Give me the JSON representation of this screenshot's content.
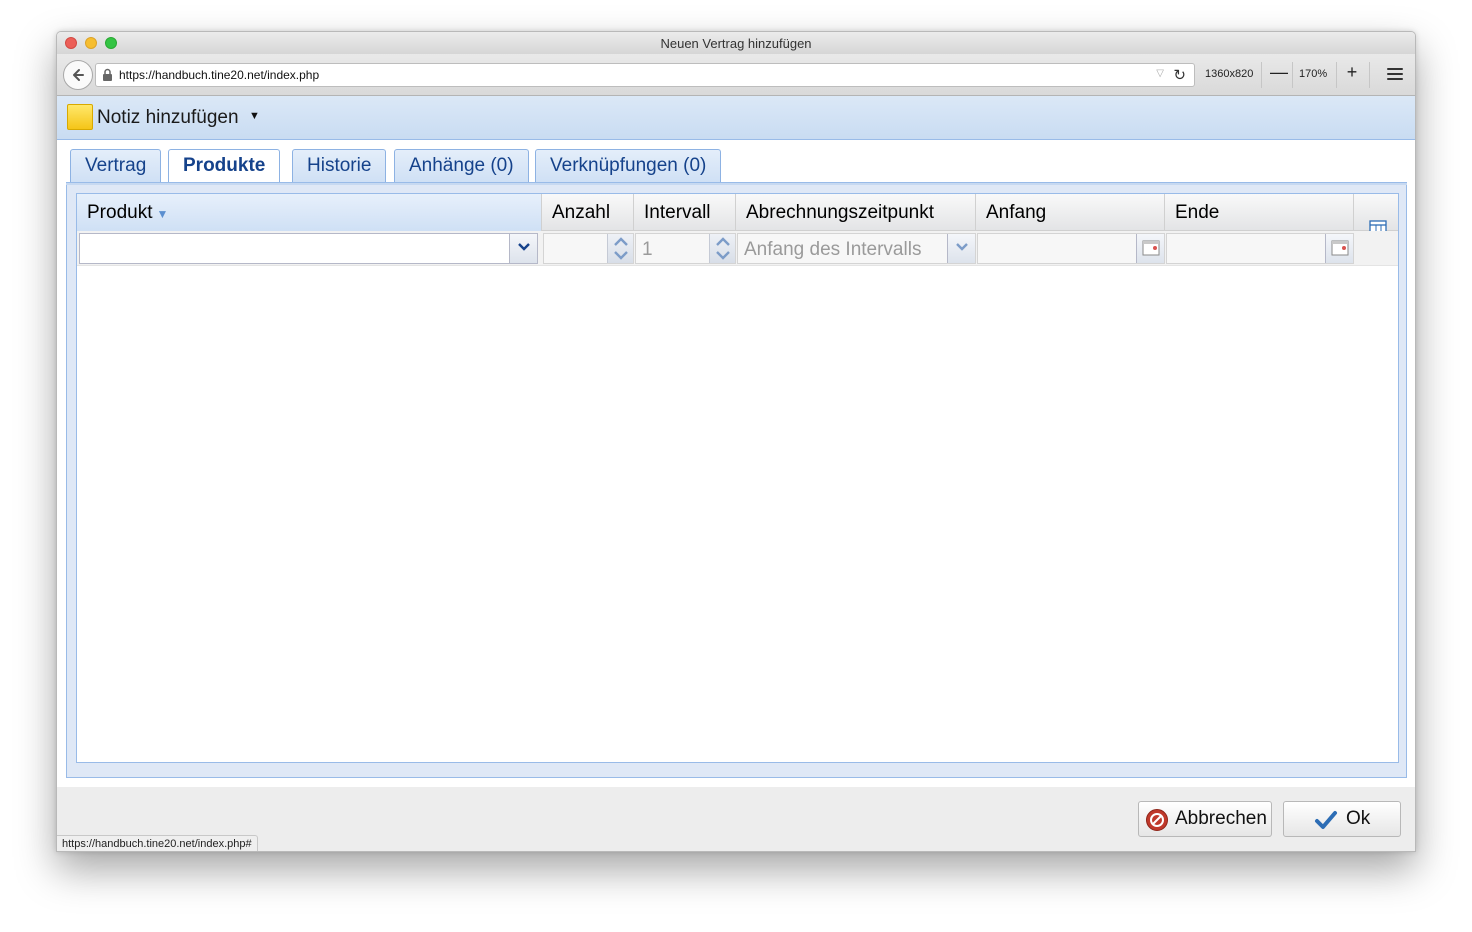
{
  "window": {
    "title": "Neuen Vertrag hinzufügen"
  },
  "browser": {
    "url": "https://handbuch.tine20.net/index.php",
    "resolution": "1360x820",
    "zoom": "170%",
    "zoom_minus": "—",
    "zoom_plus": "+",
    "status_url": "https://handbuch.tine20.net/index.php#"
  },
  "toolbar": {
    "note_label": "Notiz hinzufügen",
    "note_icon": "note-icon",
    "note_color": "#f5c518"
  },
  "tabs": [
    {
      "label": "Vertrag",
      "active": false
    },
    {
      "label": "Produkte",
      "active": true
    },
    {
      "label": "Historie",
      "active": false
    },
    {
      "label": "Anhänge (0)",
      "active": false
    },
    {
      "label": "Verknüpfungen (0)",
      "active": false
    }
  ],
  "grid": {
    "columns": [
      "Produkt",
      "Anzahl",
      "Intervall",
      "Abrechnungszeitpunkt",
      "Anfang",
      "Ende"
    ],
    "sorted_column": "Produkt",
    "editor": {
      "produkt_value": "",
      "anzahl_value": "",
      "intervall_value": "1",
      "abrechnung_placeholder": "Anfang des Intervalls",
      "anfang_value": "",
      "ende_value": ""
    },
    "rows": []
  },
  "footer": {
    "cancel_label": "Abbrechen",
    "ok_label": "Ok"
  },
  "colors": {
    "accent": "#15428b",
    "border": "#99bbe8"
  }
}
